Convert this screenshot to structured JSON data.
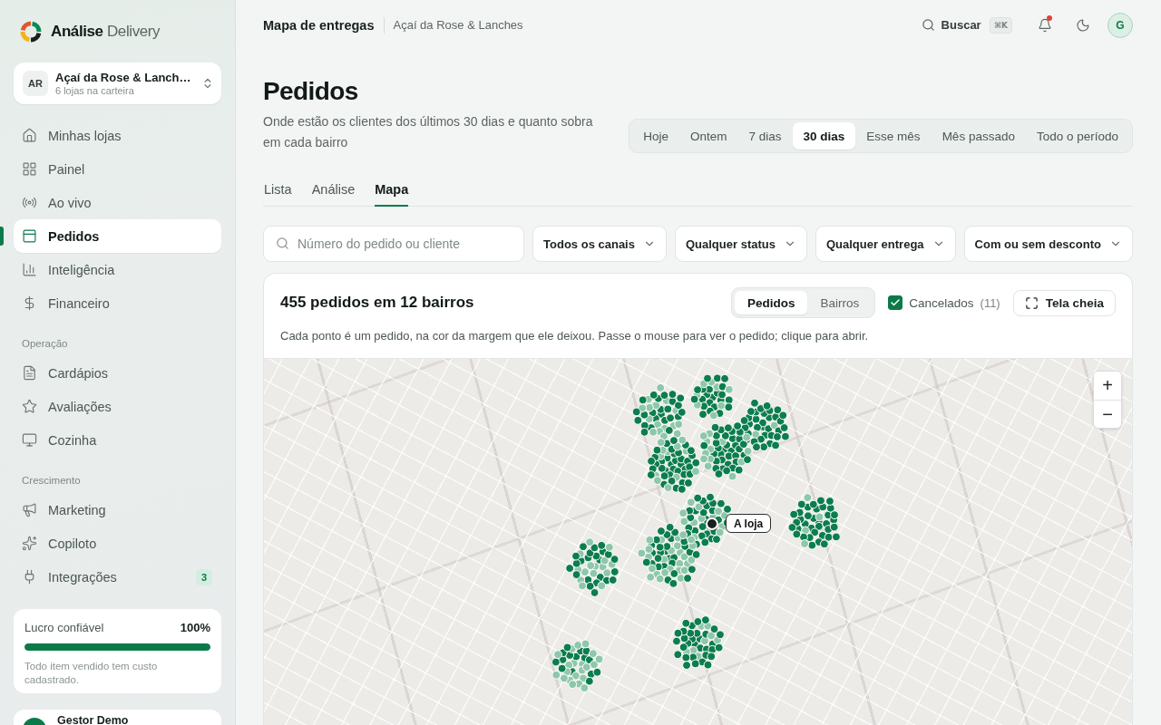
{
  "sidebar": {
    "brand": "**Análise** Delivery",
    "store": {
      "initials": "AR",
      "name": "Açaí da Rose & Lanch…",
      "subtitle": "6 lojas na carteira"
    },
    "sections": [
      {
        "items": [
          {
            "label": "Minhas lojas",
            "selected": false
          },
          {
            "label": "Painel",
            "selected": false
          },
          {
            "label": "Ao vivo",
            "selected": false
          },
          {
            "label": "Pedidos",
            "selected": true
          },
          {
            "label": "Inteligência",
            "selected": false
          },
          {
            "label": "Financeiro",
            "selected": false
          }
        ]
      },
      {
        "title": "Operação",
        "items": [
          {
            "label": "Cardápios",
            "selected": false
          },
          {
            "label": "Avaliações",
            "selected": false
          },
          {
            "label": "Cozinha",
            "selected": false
          }
        ]
      },
      {
        "title": "Crescimento",
        "items": [
          {
            "label": "Marketing",
            "selected": false
          },
          {
            "label": "Copiloto",
            "selected": false
          },
          {
            "label": "Integrações",
            "selected": false,
            "badge": "3"
          }
        ]
      }
    ],
    "profit": {
      "label": "Lucro confiável",
      "value": "100%",
      "level": 1,
      "note": "Todo item vendido tem custo cadastrado."
    },
    "user": {
      "name": "Gestor Demo"
    }
  },
  "topbar": {
    "title": "Mapa de entregas",
    "store": "Açaí da Rose & Lanches",
    "search": {
      "label": "Buscar",
      "shortcut": "⌘K"
    },
    "notifications": {
      "unread": true
    },
    "avatar": "G"
  },
  "page": {
    "title": "Pedidos",
    "description": "Onde estão os clientes dos últimos 30 dias e quanto sobra em cada bairro",
    "periods": [
      {
        "label": "Hoje",
        "selected": false
      },
      {
        "label": "Ontem",
        "selected": false
      },
      {
        "label": "7 dias",
        "selected": false
      },
      {
        "label": "30 dias",
        "selected": true
      },
      {
        "label": "Esse mês",
        "selected": false
      },
      {
        "label": "Mês passado",
        "selected": false
      },
      {
        "label": "Todo o período",
        "selected": false
      }
    ],
    "tabs": [
      {
        "label": "Lista",
        "selected": false
      },
      {
        "label": "Análise",
        "selected": false
      },
      {
        "label": "Mapa",
        "selected": true
      }
    ],
    "filters": {
      "search": {
        "placeholder": "Número do pedido ou cliente"
      },
      "dropdowns": [
        "Todos os canais",
        "Qualquer status",
        "Qualquer entrega",
        "Com ou sem desconto"
      ]
    },
    "map_panel": {
      "title": "455 pedidos em 12 bairros",
      "views": [
        {
          "label": "Pedidos",
          "selected": true
        },
        {
          "label": "Bairros",
          "selected": false
        }
      ],
      "cancelled": {
        "label": "Cancelados",
        "count": "(11)",
        "checked": true
      },
      "fullscreen": "Tela cheia",
      "description": "Cada ponto é um pedido, na cor da margem que ele deixou. Passe o mouse para ver o pedido; clique para abrir.",
      "map": {
        "store_label": "A loja",
        "zoom_in": "+",
        "zoom_out": "−"
      }
    }
  }
}
